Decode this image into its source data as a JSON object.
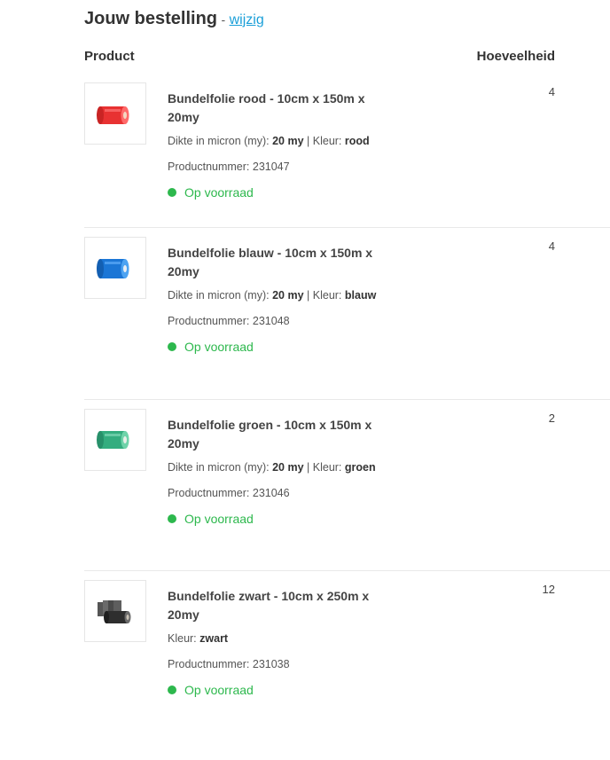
{
  "header": {
    "title": "Jouw bestelling",
    "separator": "-",
    "edit_link": "wijzig"
  },
  "columns": {
    "product": "Product",
    "quantity": "Hoeveelheid"
  },
  "items": [
    {
      "name": "Bundelfolie rood - 10cm x 150m x 20my",
      "spec_thickness_label": "Dikte in micron (my):",
      "spec_thickness_value": "20 my",
      "spec_sep": "|",
      "spec_color_label": "Kleur:",
      "spec_color_value": "rood",
      "sku": "Productnummer: 231047",
      "stock": "Op voorraad",
      "quantity": "4",
      "roll_color": "#ef3b3b",
      "icon": "red-film-roll-icon"
    },
    {
      "name": "Bundelfolie blauw - 10cm x 150m x 20my",
      "spec_thickness_label": "Dikte in micron (my):",
      "spec_thickness_value": "20 my",
      "spec_sep": "|",
      "spec_color_label": "Kleur:",
      "spec_color_value": "blauw",
      "sku": "Productnummer: 231048",
      "stock": "Op voorraad",
      "quantity": "4",
      "roll_color": "#1d7fe0",
      "icon": "blue-film-roll-icon"
    },
    {
      "name": "Bundelfolie groen - 10cm x 150m x 20my",
      "spec_thickness_label": "Dikte in micron (my):",
      "spec_thickness_value": "20 my",
      "spec_sep": "|",
      "spec_color_label": "Kleur:",
      "spec_color_value": "groen",
      "sku": "Productnummer: 231046",
      "stock": "Op voorraad",
      "quantity": "2",
      "roll_color": "#3cb88a",
      "icon": "green-film-roll-icon"
    },
    {
      "name": "Bundelfolie zwart - 10cm x 250m x 20my",
      "spec_color_label": "Kleur:",
      "spec_color_value": "zwart",
      "sku": "Productnummer: 231038",
      "stock": "Op voorraad",
      "quantity": "12",
      "roll_color": "#3a3a3a",
      "icon": "black-film-rolls-icon"
    }
  ],
  "colors": {
    "accent_link": "#1a9fd8",
    "stock_green": "#2db84d"
  }
}
